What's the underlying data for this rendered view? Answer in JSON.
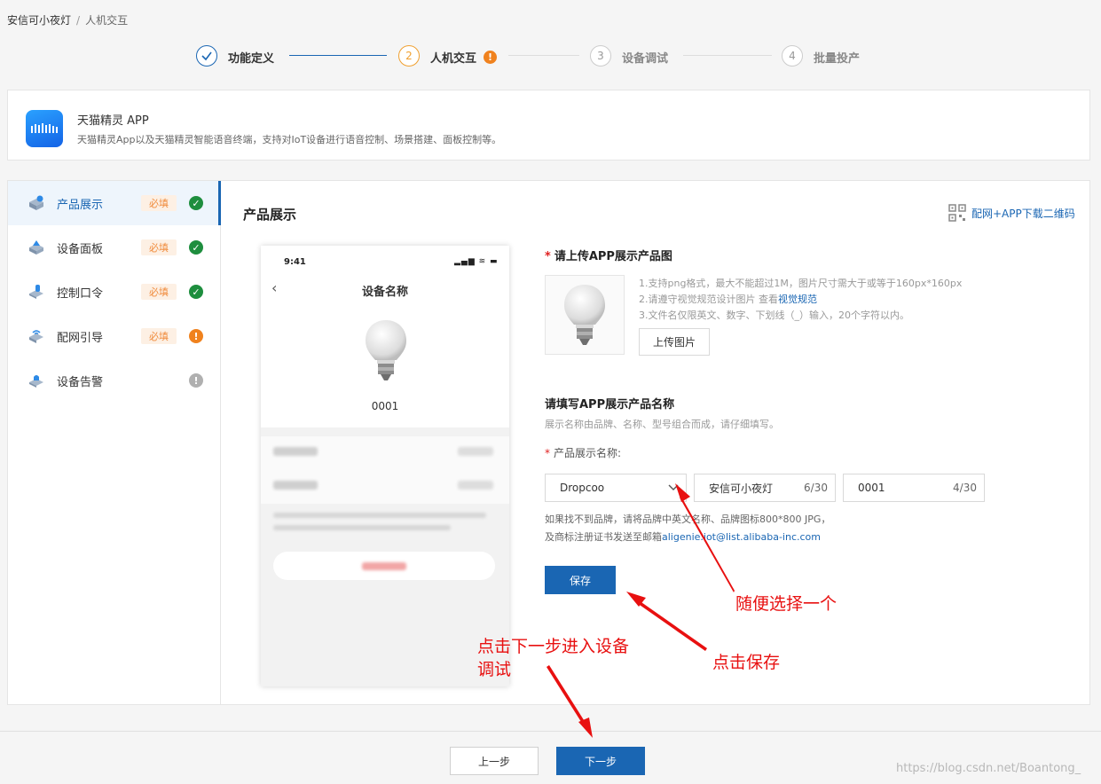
{
  "breadcrumb": {
    "root": "安信可小夜灯",
    "separator": "/",
    "current": "人机交互"
  },
  "steps": [
    {
      "number": "1",
      "label": "功能定义",
      "state": "done"
    },
    {
      "number": "2",
      "label": "人机交互",
      "state": "active",
      "badge": "!"
    },
    {
      "number": "3",
      "label": "设备调试",
      "state": "pending"
    },
    {
      "number": "4",
      "label": "批量投产",
      "state": "pending"
    }
  ],
  "app": {
    "title": "天猫精灵 APP",
    "description": "天猫精灵App以及天猫精灵智能语音终端，支持对IoT设备进行语音控制、场景搭建、面板控制等。"
  },
  "sidebar": {
    "items": [
      {
        "label": "产品展示",
        "tag": "必填",
        "status": "ok",
        "status_glyph": "✓",
        "active": true
      },
      {
        "label": "设备面板",
        "tag": "必填",
        "status": "ok",
        "status_glyph": "✓",
        "active": false
      },
      {
        "label": "控制口令",
        "tag": "必填",
        "status": "ok",
        "status_glyph": "✓",
        "active": false
      },
      {
        "label": "配网引导",
        "tag": "必填",
        "status": "warn",
        "status_glyph": "!",
        "active": false
      },
      {
        "label": "设备告警",
        "tag": "",
        "status": "grey",
        "status_glyph": "!",
        "active": false
      }
    ]
  },
  "section": {
    "title": "产品展示",
    "qr_link": "配网+APP下载二维码"
  },
  "phone": {
    "time": "9:41",
    "status": "▂▄▆ ≋ ▬",
    "back": "‹",
    "title": "设备名称",
    "device_number": "0001"
  },
  "upload": {
    "label": "请上传APP展示产品图",
    "tips": [
      "1.支持png格式，最大不能超过1M，图片尺寸需大于或等于160px*160px",
      "2.请遵守视觉规范设计图片 查看",
      "3.文件名仅限英文、数字、下划线（_）输入，20个字符以内。"
    ],
    "tips_link": "视觉规范",
    "button": "上传图片"
  },
  "name_section": {
    "title": "请填写APP展示产品名称",
    "description": "展示名称由品牌、名称、型号组合而成，请仔细填写。",
    "field_label": "产品展示名称:",
    "brand_value": "Dropcoo",
    "name_value": "安信可小夜灯",
    "name_count": "6/30",
    "model_value": "0001",
    "model_count": "4/30",
    "hint_line1": "如果找不到品牌，请将品牌中英文名称、品牌图标800*800 JPG，",
    "hint_line2": "及商标注册证书发送至邮箱",
    "hint_email": "aligenie.iot@list.alibaba-inc.com",
    "save": "保存"
  },
  "footer": {
    "prev": "上一步",
    "next": "下一步",
    "watermark": "https://blog.csdn.net/Boantong_"
  },
  "annotations": {
    "select": "随便选择一个",
    "save": "点击保存",
    "next_line1": "点击下一步进入设备",
    "next_line2": "调试"
  },
  "colors": {
    "primary": "#1a66b3",
    "warning": "#f0821e",
    "success": "#1e8e3e",
    "annotation": "#e81010"
  }
}
